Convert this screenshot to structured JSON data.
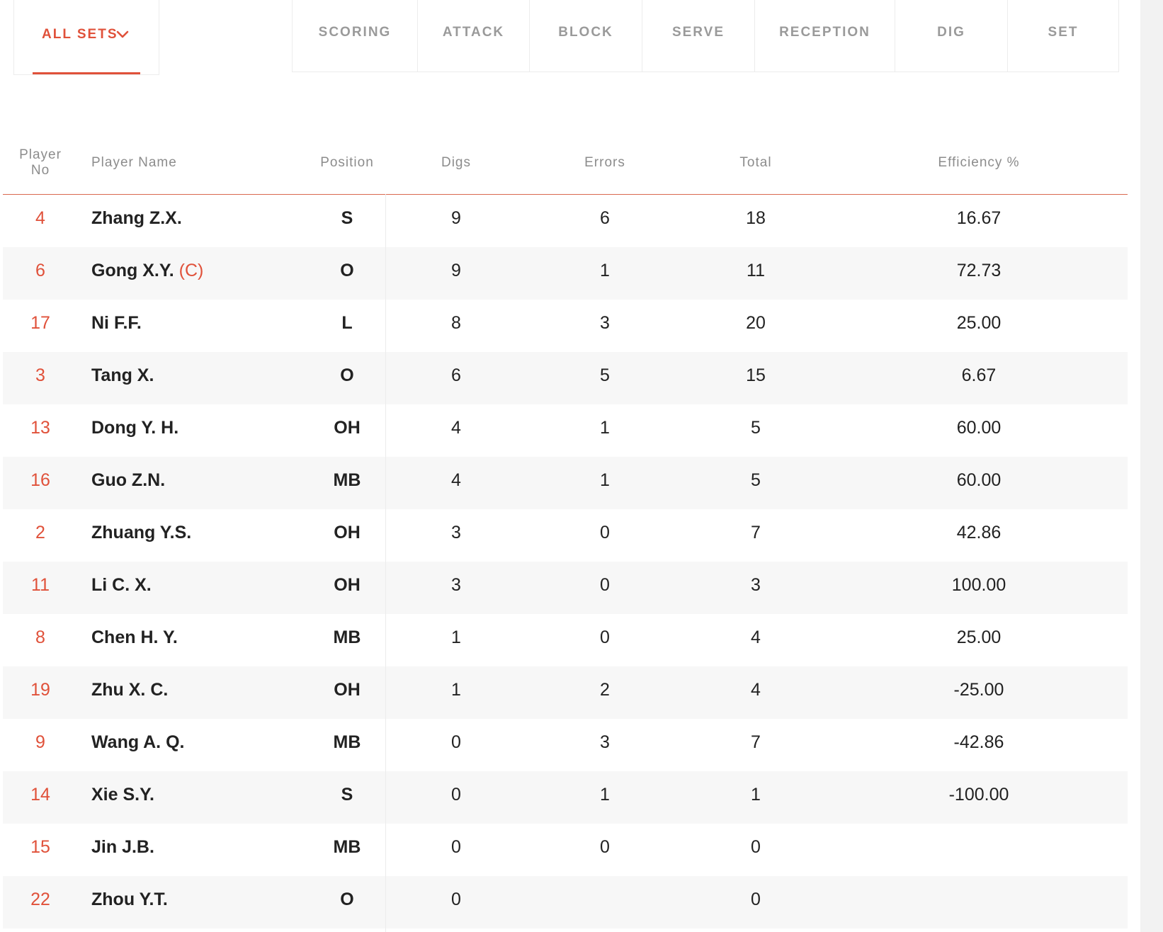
{
  "filter": {
    "label": "ALL SETS"
  },
  "tabs": [
    "SCORING",
    "ATTACK",
    "BLOCK",
    "SERVE",
    "RECEPTION",
    "DIG",
    "SET"
  ],
  "table": {
    "headers": {
      "player_no_line1": "Player",
      "player_no_line2": "No",
      "player_name": "Player Name",
      "position": "Position",
      "digs": "Digs",
      "errors": "Errors",
      "total": "Total",
      "efficiency": "Efficiency %"
    },
    "rows": [
      {
        "no": "4",
        "name": "Zhang Z.X.",
        "captain": "",
        "pos": "S",
        "digs": "9",
        "errors": "6",
        "total": "18",
        "eff": "16.67"
      },
      {
        "no": "6",
        "name": "Gong X.Y.",
        "captain": "(C)",
        "pos": "O",
        "digs": "9",
        "errors": "1",
        "total": "11",
        "eff": "72.73"
      },
      {
        "no": "17",
        "name": "Ni F.F.",
        "captain": "",
        "pos": "L",
        "digs": "8",
        "errors": "3",
        "total": "20",
        "eff": "25.00"
      },
      {
        "no": "3",
        "name": "Tang X.",
        "captain": "",
        "pos": "O",
        "digs": "6",
        "errors": "5",
        "total": "15",
        "eff": "6.67"
      },
      {
        "no": "13",
        "name": "Dong Y. H.",
        "captain": "",
        "pos": "OH",
        "digs": "4",
        "errors": "1",
        "total": "5",
        "eff": "60.00"
      },
      {
        "no": "16",
        "name": "Guo Z.N.",
        "captain": "",
        "pos": "MB",
        "digs": "4",
        "errors": "1",
        "total": "5",
        "eff": "60.00"
      },
      {
        "no": "2",
        "name": "Zhuang Y.S.",
        "captain": "",
        "pos": "OH",
        "digs": "3",
        "errors": "0",
        "total": "7",
        "eff": "42.86"
      },
      {
        "no": "11",
        "name": "Li C. X.",
        "captain": "",
        "pos": "OH",
        "digs": "3",
        "errors": "0",
        "total": "3",
        "eff": "100.00"
      },
      {
        "no": "8",
        "name": "Chen H. Y.",
        "captain": "",
        "pos": "MB",
        "digs": "1",
        "errors": "0",
        "total": "4",
        "eff": "25.00"
      },
      {
        "no": "19",
        "name": "Zhu X. C.",
        "captain": "",
        "pos": "OH",
        "digs": "1",
        "errors": "2",
        "total": "4",
        "eff": "-25.00"
      },
      {
        "no": "9",
        "name": "Wang A. Q.",
        "captain": "",
        "pos": "MB",
        "digs": "0",
        "errors": "3",
        "total": "7",
        "eff": "-42.86"
      },
      {
        "no": "14",
        "name": "Xie S.Y.",
        "captain": "",
        "pos": "S",
        "digs": "0",
        "errors": "1",
        "total": "1",
        "eff": "-100.00"
      },
      {
        "no": "15",
        "name": "Jin J.B.",
        "captain": "",
        "pos": "MB",
        "digs": "0",
        "errors": "0",
        "total": "0",
        "eff": ""
      },
      {
        "no": "22",
        "name": "Zhou Y.T.",
        "captain": "",
        "pos": "O",
        "digs": "0",
        "errors": "",
        "total": "0",
        "eff": ""
      }
    ]
  },
  "colors": {
    "accent": "#e0513a",
    "muted": "#9a9a9a",
    "text": "#222222",
    "row_alt": "#f7f7f7"
  }
}
